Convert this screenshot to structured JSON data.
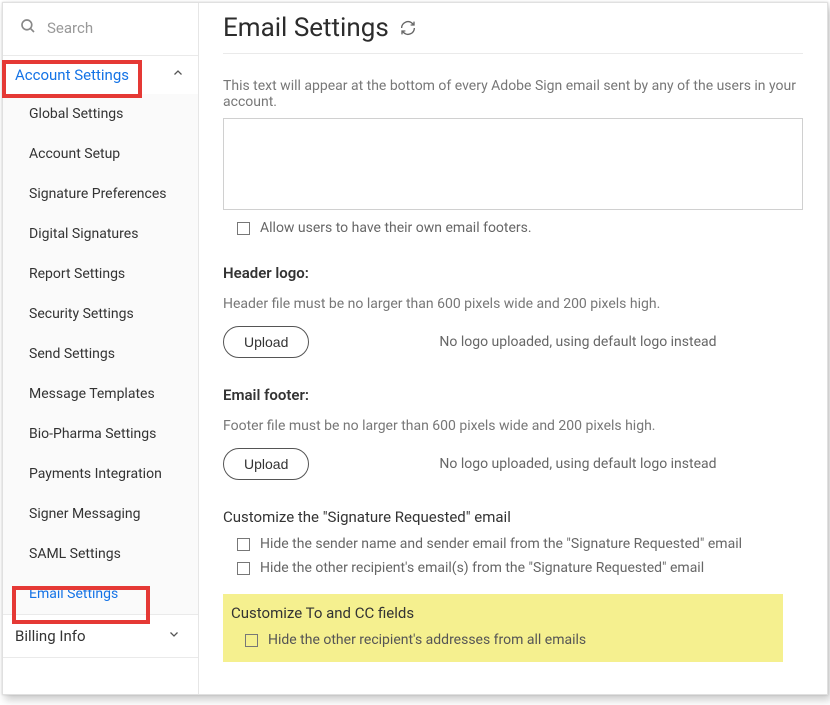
{
  "search": {
    "placeholder": "Search"
  },
  "sidebar": {
    "accountHeader": "Account Settings",
    "items": [
      {
        "label": "Global Settings"
      },
      {
        "label": "Account Setup"
      },
      {
        "label": "Signature Preferences"
      },
      {
        "label": "Digital Signatures"
      },
      {
        "label": "Report Settings"
      },
      {
        "label": "Security Settings"
      },
      {
        "label": "Send Settings"
      },
      {
        "label": "Message Templates"
      },
      {
        "label": "Bio-Pharma Settings"
      },
      {
        "label": "Payments Integration"
      },
      {
        "label": "Signer Messaging"
      },
      {
        "label": "SAML Settings"
      },
      {
        "label": "Email Settings"
      }
    ],
    "billing": "Billing Info"
  },
  "main": {
    "title": "Email Settings",
    "footerHelp": "This text will appear at the bottom of every Adobe Sign email sent by any of the users in your account.",
    "allowOwnFooters": "Allow users to have their own email footers.",
    "headerLogo": {
      "title": "Header logo:",
      "hint": "Header file must be no larger than 600 pixels wide and 200 pixels high.",
      "upload": "Upload",
      "status": "No logo uploaded, using default logo instead"
    },
    "emailFooter": {
      "title": "Email footer:",
      "hint": "Footer file must be no larger than 600 pixels wide and 200 pixels high.",
      "upload": "Upload",
      "status": "No logo uploaded, using default logo instead"
    },
    "sigRequested": {
      "title": "Customize the \"Signature Requested\" email",
      "opt1": "Hide the sender name and sender email from the \"Signature Requested\" email",
      "opt2": "Hide the other recipient's email(s) from the \"Signature Requested\" email"
    },
    "toCc": {
      "title": "Customize To and CC fields",
      "opt1": "Hide the other recipient's addresses from all emails"
    }
  }
}
